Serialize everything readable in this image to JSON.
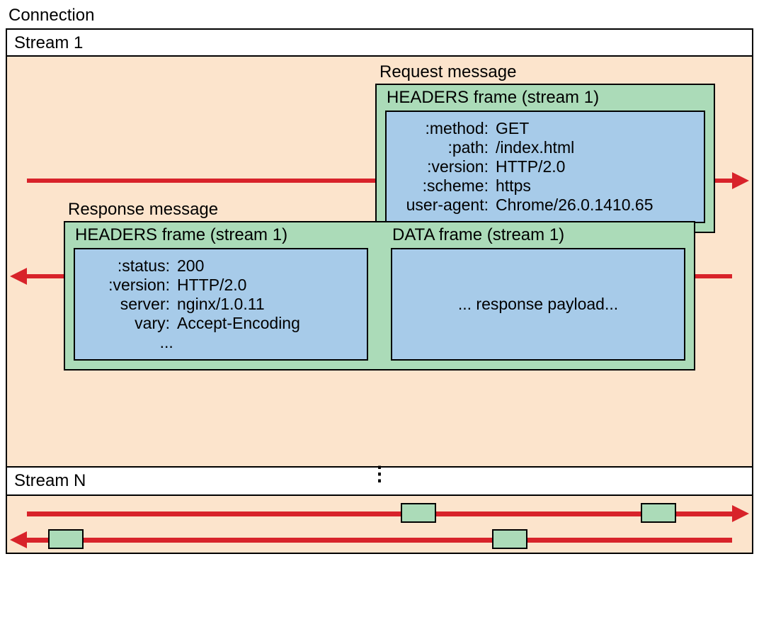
{
  "title": "Connection",
  "stream1": {
    "label": "Stream 1",
    "request": {
      "label": "Request message",
      "headers_frame_title": "HEADERS frame (stream 1)",
      "fields": [
        {
          "k": ":method:",
          "v": "GET"
        },
        {
          "k": ":path:",
          "v": "/index.html"
        },
        {
          "k": ":version:",
          "v": "HTTP/2.0"
        },
        {
          "k": ":scheme:",
          "v": "https"
        },
        {
          "k": "user-agent:",
          "v": "Chrome/26.0.1410.65"
        }
      ]
    },
    "response": {
      "label": "Response message",
      "headers_frame_title": "HEADERS frame (stream 1)",
      "data_frame_title": "DATA frame (stream 1)",
      "headers_fields": [
        {
          "k": ":status:",
          "v": "200"
        },
        {
          "k": ":version:",
          "v": "HTTP/2.0"
        },
        {
          "k": "server:",
          "v": "nginx/1.0.11"
        },
        {
          "k": "vary:",
          "v": "Accept-Encoding"
        }
      ],
      "headers_ellipsis": "...",
      "data_body": "... response payload..."
    }
  },
  "streamN": {
    "label": "Stream N"
  }
}
